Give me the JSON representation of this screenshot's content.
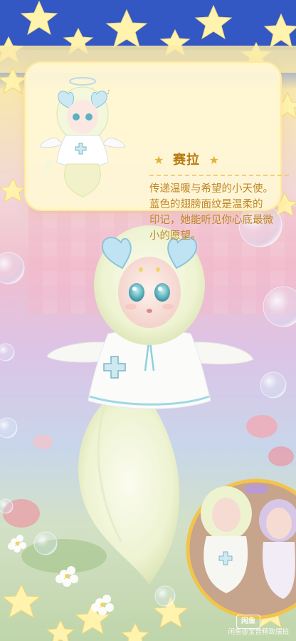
{
  "card": {
    "name": "赛拉",
    "description_lines": [
      "传递温暖与希望的小天使。",
      "蓝色的翅膀面纹是温柔的",
      "印记，她能听见你心底最微",
      "小的愿望。"
    ]
  },
  "watermark": {
    "logo_text": "闲鱼",
    "caption": "闲鱼@宝普精致摆拍"
  },
  "colors": {
    "sky": "#3b5fc4",
    "star": "#fff2a8",
    "card_bg": "#fff7d6",
    "card_title": "#b87a12",
    "card_text": "#bf8626",
    "fur": "#f3f6d8",
    "heart_ears": "#bfe3f2",
    "eye": "#6cc2cf"
  }
}
